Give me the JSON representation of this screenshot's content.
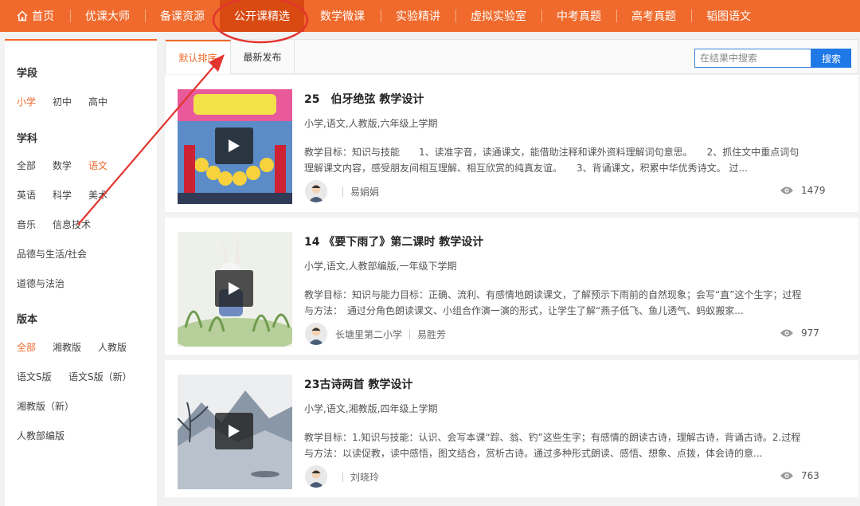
{
  "nav": {
    "items": [
      {
        "label": "首页",
        "icon": "home-icon"
      },
      {
        "label": "优课大师"
      },
      {
        "label": "备课资源"
      },
      {
        "label": "公开课精选",
        "active": true
      },
      {
        "label": "数学微课"
      },
      {
        "label": "实验精讲"
      },
      {
        "label": "虚拟实验室"
      },
      {
        "label": "中考真题"
      },
      {
        "label": "高考真题"
      },
      {
        "label": "韬图语文"
      }
    ]
  },
  "sidebar": {
    "stage": {
      "heading": "学段",
      "items": [
        "小学",
        "初中",
        "高中"
      ],
      "selected": "小学"
    },
    "subject": {
      "heading": "学科",
      "items": [
        "全部",
        "数学",
        "语文",
        "英语",
        "科学",
        "美术",
        "音乐",
        "信息技术",
        "品德与生活/社会",
        "道德与法治"
      ],
      "selected": "语文"
    },
    "edition": {
      "heading": "版本",
      "items": [
        "全部",
        "湘教版",
        "人教版",
        "语文S版",
        "语文S版（新）",
        "湘教版（新）",
        "人教部编版"
      ],
      "selected": "全部"
    }
  },
  "tabs": {
    "default_label": "默认排序",
    "latest_label": "最新发布"
  },
  "search": {
    "placeholder": "在结果中搜索",
    "button_label": "搜索"
  },
  "results": [
    {
      "title": "25　伯牙绝弦 教学设计",
      "meta": "小学,语文,人教版,六年级上学期",
      "desc": "教学目标：知识与技能　　1、读准字音，读通课文，能借助注释和课外资料理解词句意思。　　2、抓住文中重点词句理解课文内容，感受朋友间相互理解、相互欣赏的纯真友谊。　　3、背诵课文，积累中华优秀诗文。 过...",
      "school": "",
      "author": "易娟娟",
      "views": "1479"
    },
    {
      "title": "14 《要下雨了》第二课时 教学设计",
      "meta": "小学,语文,人教部编版,一年级下学期",
      "desc": "教学目标：知识与能力目标：正确、流利、有感情地朗读课文，了解预示下雨前的自然现象；会写“直”这个生字；过程与方法：　通过分角色朗读课文、小组合作演一演的形式，让学生了解“燕子低飞、鱼儿透气、蚂蚁搬家...",
      "school": "长塘里第二小学",
      "author": "易胜芳",
      "views": "977"
    },
    {
      "title": "23古诗两首 教学设计",
      "meta": "小学,语文,湘教版,四年级上学期",
      "desc": "教学目标：1.知识与技能：认识、会写本课“踪、翁、钓”这些生字；有感情的朗读古诗，理解古诗，背诵古诗。2.过程与方法：以读促教，读中感悟，图文结合，赏析古诗。通过多种形式朗读、感悟、想象、点拨，体会诗的意...",
      "school": "",
      "author": "刘晓玲",
      "views": "763"
    }
  ],
  "colors": {
    "brand": "#ef6a2c",
    "brand_active": "#d94a12",
    "search_button": "#1e78e6",
    "annotation": "#e3342f"
  },
  "icons": [
    "home-icon",
    "play-icon",
    "eye-icon",
    "avatar-icon"
  ]
}
